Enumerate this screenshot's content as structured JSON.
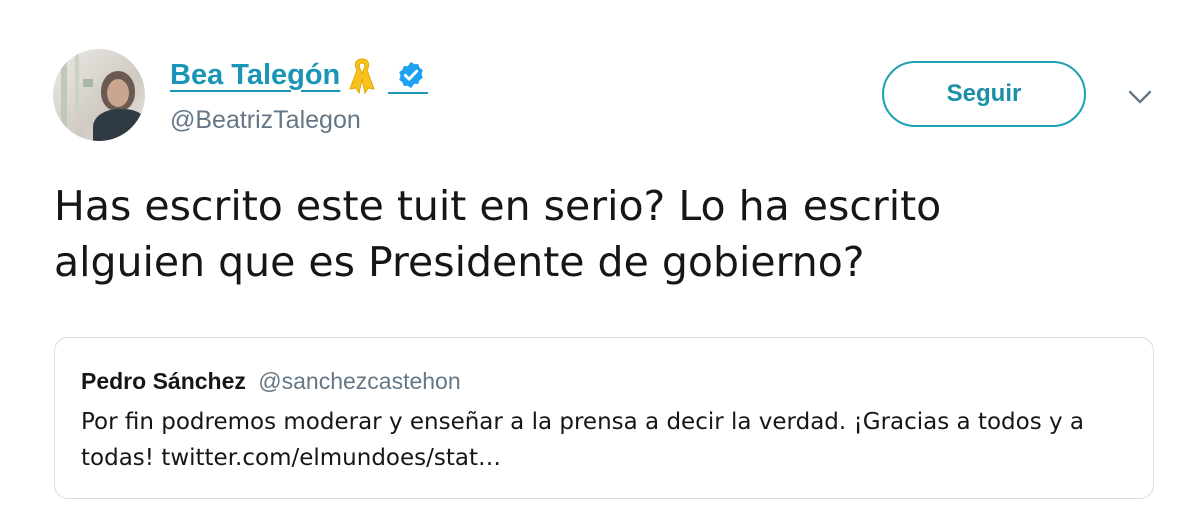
{
  "author": {
    "display_name": "Bea Talegón",
    "handle": "@BeatrizTalegon",
    "avatar_icon": "profile-photo",
    "ribbon_icon": "yellow-ribbon-icon",
    "verified_icon": "verified-badge-icon"
  },
  "follow_button": {
    "label": "Seguir"
  },
  "menu_icon": "chevron-down-icon",
  "tweet": {
    "line1": "Has escrito este tuit en serio? Lo ha escrito",
    "line2": "alguien que es Presidente de gobierno?"
  },
  "quoted_tweet": {
    "name": "Pedro Sánchez",
    "handle": "@sanchezcastehon",
    "line1": "Por fin podremos moderar y enseñar a la prensa a decir la verdad. ¡Gracias a todos y a",
    "line2": "todas! twitter.com/elmundoes/stat…"
  },
  "colors": {
    "accent": "#1b95b5",
    "verified": "#1da1f2",
    "ribbon": "#f7c21b",
    "text": "#14171a",
    "secondary_text": "#657786",
    "border": "#d6dde3"
  }
}
